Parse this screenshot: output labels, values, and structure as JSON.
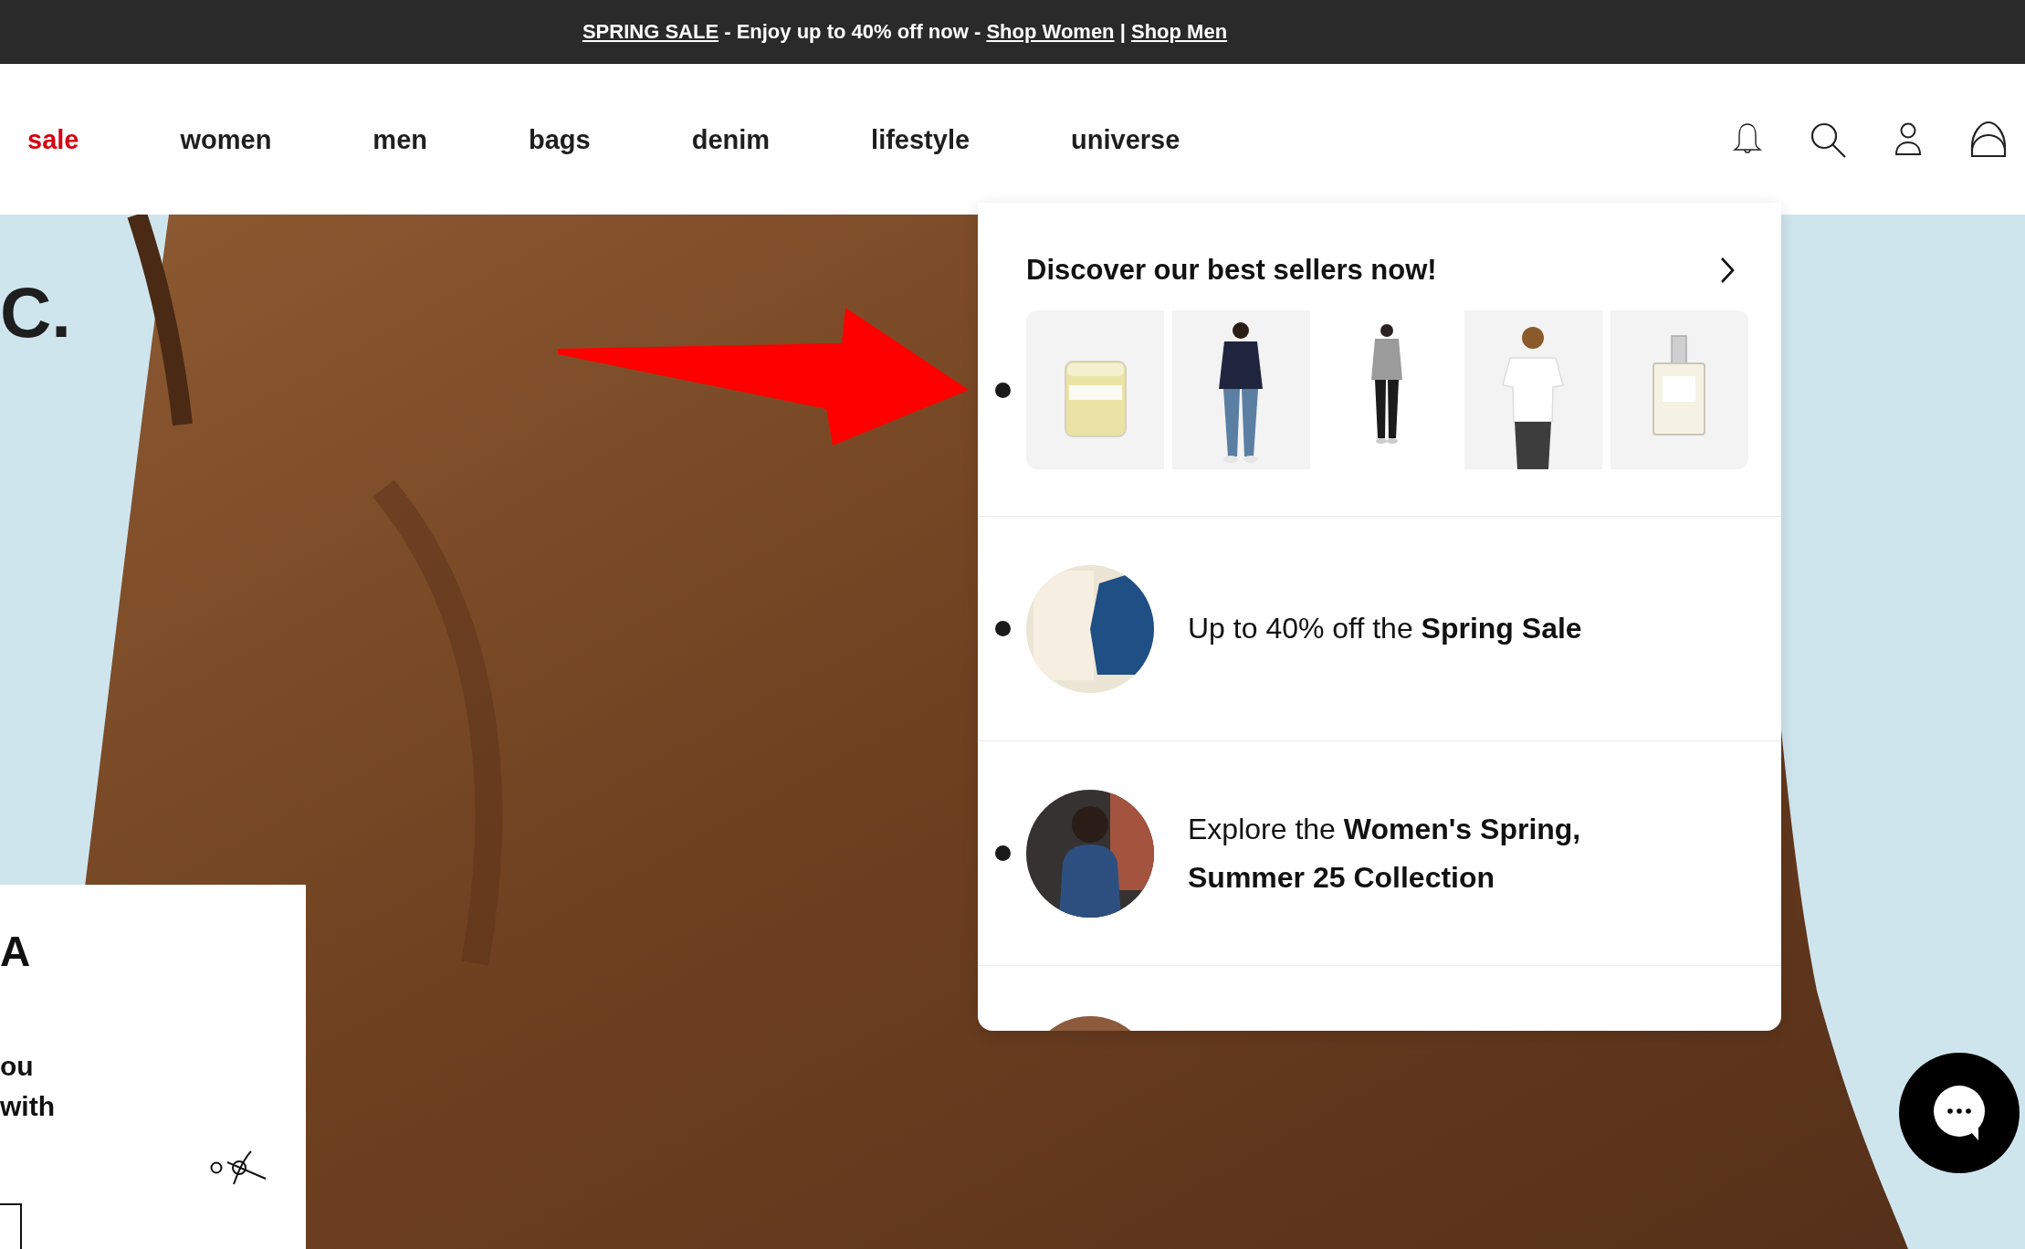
{
  "announcement": {
    "parts": [
      {
        "kind": "link",
        "text": "SPRING SALE"
      },
      {
        "kind": "text",
        "text": "- Enjoy up to 40% off now -"
      },
      {
        "kind": "link",
        "text": "Shop Women"
      },
      {
        "kind": "text",
        "text": "|"
      },
      {
        "kind": "link",
        "text": "Shop Men"
      }
    ]
  },
  "nav": {
    "items": [
      {
        "label": "sale",
        "color": "#d40511"
      },
      {
        "label": "women",
        "color": "#1e1e1e"
      },
      {
        "label": "men",
        "color": "#1e1e1e"
      },
      {
        "label": "bags",
        "color": "#1e1e1e"
      },
      {
        "label": "denim",
        "color": "#1e1e1e"
      },
      {
        "label": "lifestyle",
        "color": "#1e1e1e"
      },
      {
        "label": "universe",
        "color": "#1e1e1e"
      }
    ]
  },
  "hero": {
    "headline": "C."
  },
  "best_sellers": {
    "title": "Discover our best sellers now!"
  },
  "promos": [
    {
      "text": "Up to 40% off the **Spring Sale**"
    },
    {
      "text": "Explore the **Women's Spring, Summer 25 Collection**"
    }
  ],
  "side_card": {
    "title": "A",
    "lines": [
      "ou",
      "with"
    ]
  }
}
